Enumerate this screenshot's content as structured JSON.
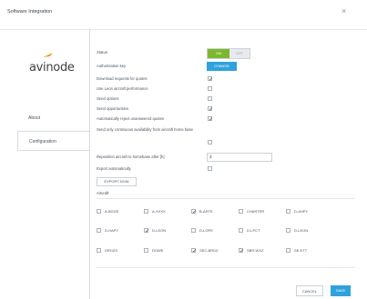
{
  "window": {
    "title": "Software Integration",
    "close_glyph": "×"
  },
  "sidebar": {
    "logo_text": "avinode",
    "items": [
      {
        "label": "About"
      },
      {
        "label": "Configuration"
      }
    ]
  },
  "settings": {
    "status_label": "Status",
    "status_on": "ON",
    "status_off": "OFF",
    "auth_key_label": "Authorisation key",
    "change_button": "CHANGE",
    "download_requests_label": "Download requests for quotes",
    "use_aircraft_performance_label": "Use Leon aircraft performance",
    "send_options_label": "Send options",
    "send_opportunities_label": "Send opportunities",
    "auto_reject_label": "Automatically reject unanswered quotes",
    "send_continuous_label": "Send only continuous availability from aircraft home base",
    "reposition_label": "Reposition aircraft to homebase after [h]",
    "reposition_value": "3",
    "export_auto_label": "Export automatically",
    "export_now_button": "EXPORT NOW",
    "aircraft_section_label": "Aircraft"
  },
  "checks": {
    "download_requests": true,
    "use_aircraft_performance": false,
    "send_options": false,
    "send_opportunities": true,
    "auto_reject": true,
    "send_continuous": false,
    "export_auto": false
  },
  "aircraft": [
    {
      "reg": "A-BGGE",
      "checked": false
    },
    {
      "reg": "A-XXXX",
      "checked": false
    },
    {
      "reg": "B-ARTE",
      "checked": true
    },
    {
      "reg": "CHARTER",
      "checked": false
    },
    {
      "reg": "D-AHPY",
      "checked": false
    },
    {
      "reg": "D-HAPY",
      "checked": false
    },
    {
      "reg": "D-LEON",
      "checked": true
    },
    {
      "reg": "D-LOPE",
      "checked": false
    },
    {
      "reg": "D-LPCT",
      "checked": false
    },
    {
      "reg": "D-LEON",
      "checked": false
    },
    {
      "reg": "DROZS",
      "checked": false
    },
    {
      "reg": "DOWE",
      "checked": false
    },
    {
      "reg": "SEC-BRDZ",
      "checked": true
    },
    {
      "reg": "SBR-WXZ",
      "checked": true
    },
    {
      "reg": "SE-KTT",
      "checked": false
    }
  ],
  "footer": {
    "cancel_button": "CANCEL",
    "save_button": "SAVE"
  },
  "colors": {
    "accent_blue": "#2fa2dc",
    "toggle_green": "#7cb82f",
    "logo_orange": "#f0a030"
  }
}
